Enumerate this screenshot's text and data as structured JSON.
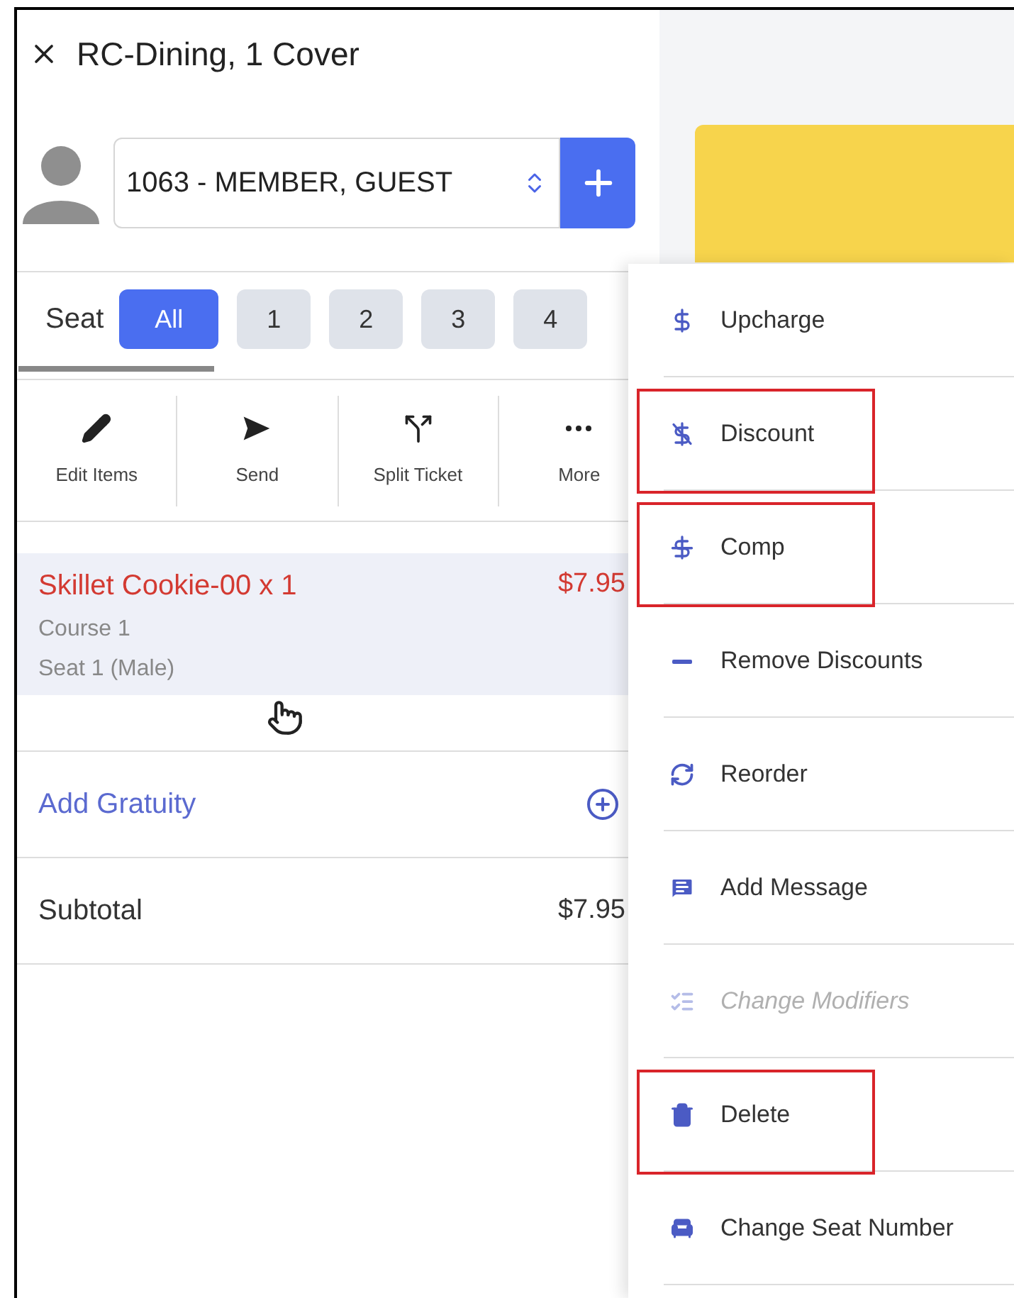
{
  "header": {
    "title": "RC-Dining, 1 Cover"
  },
  "customer": {
    "value": "1063 - MEMBER, GUEST"
  },
  "seats": {
    "label": "Seat",
    "options": [
      {
        "label": "All",
        "selected": true
      },
      {
        "label": "1",
        "selected": false
      },
      {
        "label": "2",
        "selected": false
      },
      {
        "label": "3",
        "selected": false
      },
      {
        "label": "4",
        "selected": false
      }
    ]
  },
  "actions": [
    {
      "label": "Edit Items",
      "kind": "pencil"
    },
    {
      "label": "Send",
      "kind": "send"
    },
    {
      "label": "Split Ticket",
      "kind": "split"
    },
    {
      "label": "More",
      "kind": "more"
    }
  ],
  "order_items": [
    {
      "name": "Skillet Cookie-00 x 1",
      "price": "$7.95",
      "details": [
        "Course 1",
        "Seat 1 (Male)"
      ],
      "selected": true
    }
  ],
  "gratuity": {
    "label": "Add Gratuity"
  },
  "subtotal": {
    "label": "Subtotal",
    "amount": "$7.95"
  },
  "context_menu": {
    "items": [
      {
        "label": "Upcharge",
        "kind": "dollar",
        "disabled": false,
        "highlighted": false
      },
      {
        "label": "Discount",
        "kind": "discount",
        "disabled": false,
        "highlighted": true
      },
      {
        "label": "Comp",
        "kind": "comp",
        "disabled": false,
        "highlighted": true
      },
      {
        "label": "Remove Discounts",
        "kind": "minus",
        "disabled": false,
        "highlighted": false
      },
      {
        "label": "Reorder",
        "kind": "reorder",
        "disabled": false,
        "highlighted": false
      },
      {
        "label": "Add Message",
        "kind": "message",
        "disabled": false,
        "highlighted": false
      },
      {
        "label": "Change Modifiers",
        "kind": "modifiers",
        "disabled": true,
        "highlighted": false
      },
      {
        "label": "Delete",
        "kind": "delete",
        "disabled": false,
        "highlighted": true
      },
      {
        "label": "Change Seat Number",
        "kind": "seat",
        "disabled": false,
        "highlighted": false
      }
    ]
  }
}
